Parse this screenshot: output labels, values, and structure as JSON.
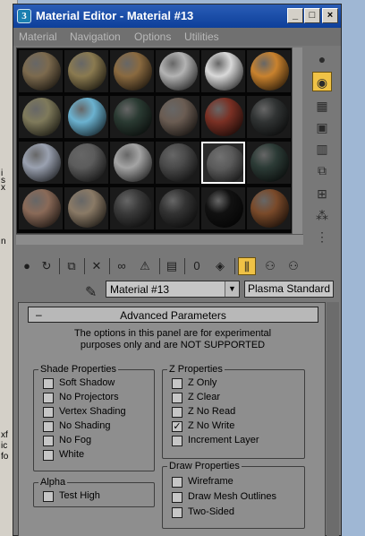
{
  "window": {
    "title": "Material Editor - Material #13",
    "min": "_",
    "max": "□",
    "close": "×"
  },
  "menu": [
    "Material",
    "Navigation",
    "Options",
    "Utilities"
  ],
  "spheres": [
    [
      "#7c6a4e",
      "#8a7a50",
      "#8a6a40",
      "#b3b3b3",
      "#d9d9d9",
      "#c9822e"
    ],
    [
      "#7f7a5b",
      "#6bb2d0",
      "#2a3a32",
      "#6a5c52",
      "#7a3024",
      "#303333"
    ],
    [
      "#9aa1b0",
      "#5c5c5c",
      "#a4a4a4",
      "#4a4a4a",
      "#5a5a5a",
      "#2c3b36"
    ],
    [
      "#8a6a58",
      "#8a7a66",
      "#3a3a3a",
      "#333333",
      "#111111",
      "#7a4a2a"
    ]
  ],
  "selected_slot": "2-4",
  "material_name": "Material #13",
  "material_type": "Plasma Standard",
  "rollout_title": "Advanced Parameters",
  "note_line1": "The options in this panel are for experimental",
  "note_line2": "purposes only and are NOT SUPPORTED",
  "shade": {
    "title": "Shade Properties",
    "items": [
      {
        "label": "Soft Shadow",
        "checked": false
      },
      {
        "label": "No Projectors",
        "checked": false
      },
      {
        "label": "Vertex Shading",
        "checked": false
      },
      {
        "label": "No Shading",
        "checked": false
      },
      {
        "label": "No Fog",
        "checked": false
      },
      {
        "label": "White",
        "checked": false
      }
    ]
  },
  "zprops": {
    "title": "Z Properties",
    "items": [
      {
        "label": "Z Only",
        "checked": false
      },
      {
        "label": "Z Clear",
        "checked": false
      },
      {
        "label": "Z No Read",
        "checked": false
      },
      {
        "label": "Z No Write",
        "checked": true
      },
      {
        "label": "Increment Layer",
        "checked": false
      }
    ]
  },
  "alpha": {
    "title": "Alpha",
    "items": [
      {
        "label": "Test High",
        "checked": false
      }
    ]
  },
  "draw": {
    "title": "Draw Properties",
    "items": [
      {
        "label": "Wireframe",
        "checked": false
      },
      {
        "label": "Draw Mesh Outlines",
        "checked": false
      },
      {
        "label": "Two-Sided",
        "checked": false
      }
    ]
  },
  "bg_text": [
    "i",
    "s",
    "x",
    "n",
    "xf",
    "ic",
    "fo"
  ],
  "accent": "#f0c246"
}
